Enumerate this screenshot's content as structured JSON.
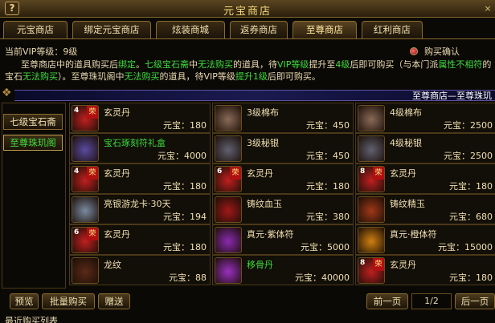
{
  "window": {
    "title": "元宝商店",
    "help": "?"
  },
  "tabs": [
    "元宝商店",
    "绑定元宝商店",
    "炫装商城",
    "返券商店",
    "至尊商店",
    "红利商店"
  ],
  "active_tab": 4,
  "vip": {
    "label": "当前VIP等级：9级"
  },
  "buy_confirm": {
    "label": "购买确认"
  },
  "notice": {
    "p1": "至尊商店中的道具购买后",
    "p2": "绑定",
    "p3": "。",
    "p4": "七级宝石斋",
    "p5": "中",
    "p6": "无法购买",
    "p7": "的道具，待",
    "p8": "VIP等级",
    "p9": "提升至",
    "p10": "4级",
    "p11": "后即可购买（与本门派",
    "p12": "属性不相符",
    "p13": "的宝石",
    "p14": "无法购买",
    "p15": "）。至尊珠玑阁中",
    "p16": "无法购买",
    "p17": "的道具，待VIP等级",
    "p18": "提升1级",
    "p19": "后即可购买。"
  },
  "banner": {
    "text": "至尊商店—至尊珠玑"
  },
  "sidebar": [
    "七级宝石斋",
    "至尊珠玑阁"
  ],
  "items": [
    {
      "name": "玄灵丹",
      "price": "元宝：180",
      "lvl": "4",
      "color": "#c02020",
      "tag": "荣"
    },
    {
      "name": "3级棉布",
      "price": "元宝：450",
      "lvl": "",
      "color": "#8a6a58",
      "tag": ""
    },
    {
      "name": "4级棉布",
      "price": "元宝：2500",
      "lvl": "",
      "color": "#8a6a58",
      "tag": ""
    },
    {
      "name": "宝石琢刻符礼盒",
      "price": "元宝：4000",
      "lvl": "",
      "color": "#5a4aa0",
      "tag": "",
      "green": true
    },
    {
      "name": "3级秘银",
      "price": "元宝：450",
      "lvl": "",
      "color": "#606070",
      "tag": ""
    },
    {
      "name": "4级秘银",
      "price": "元宝：2500",
      "lvl": "",
      "color": "#606070",
      "tag": ""
    },
    {
      "name": "玄灵丹",
      "price": "元宝：180",
      "lvl": "4",
      "color": "#c02020",
      "tag": "荣"
    },
    {
      "name": "玄灵丹",
      "price": "元宝：180",
      "lvl": "6",
      "color": "#c02020",
      "tag": "荣"
    },
    {
      "name": "玄灵丹",
      "price": "元宝：180",
      "lvl": "8",
      "color": "#c02020",
      "tag": "荣"
    },
    {
      "name": "亮银游龙卡·30天",
      "price": "元宝：194",
      "lvl": "",
      "color": "#7a8aa0",
      "tag": ""
    },
    {
      "name": "铸纹血玉",
      "price": "元宝：380",
      "lvl": "",
      "color": "#a01818",
      "tag": ""
    },
    {
      "name": "铸纹精玉",
      "price": "元宝：680",
      "lvl": "",
      "color": "#a03818",
      "tag": ""
    },
    {
      "name": "玄灵丹",
      "price": "元宝：180",
      "lvl": "6",
      "color": "#c02020",
      "tag": "荣"
    },
    {
      "name": "真元·紫体符",
      "price": "元宝：5000",
      "lvl": "",
      "color": "#8a2ab0",
      "tag": ""
    },
    {
      "name": "真元·橙体符",
      "price": "元宝：15000",
      "lvl": "",
      "color": "#d08010",
      "tag": ""
    },
    {
      "name": "龙纹",
      "price": "元宝：88",
      "lvl": "",
      "color": "#5a2a18",
      "tag": ""
    },
    {
      "name": "移骨丹",
      "price": "元宝：40000",
      "lvl": "",
      "color": "#9a30c0",
      "tag": "",
      "green": true
    },
    {
      "name": "玄灵丹",
      "price": "元宝：180",
      "lvl": "8",
      "color": "#c02020",
      "tag": "荣"
    }
  ],
  "buttons": {
    "preview": "预览",
    "bulk": "批量购买",
    "gift": "赠送",
    "prev": "前一页",
    "next": "后一页"
  },
  "page": "1/2",
  "recent": "最近购买列表"
}
